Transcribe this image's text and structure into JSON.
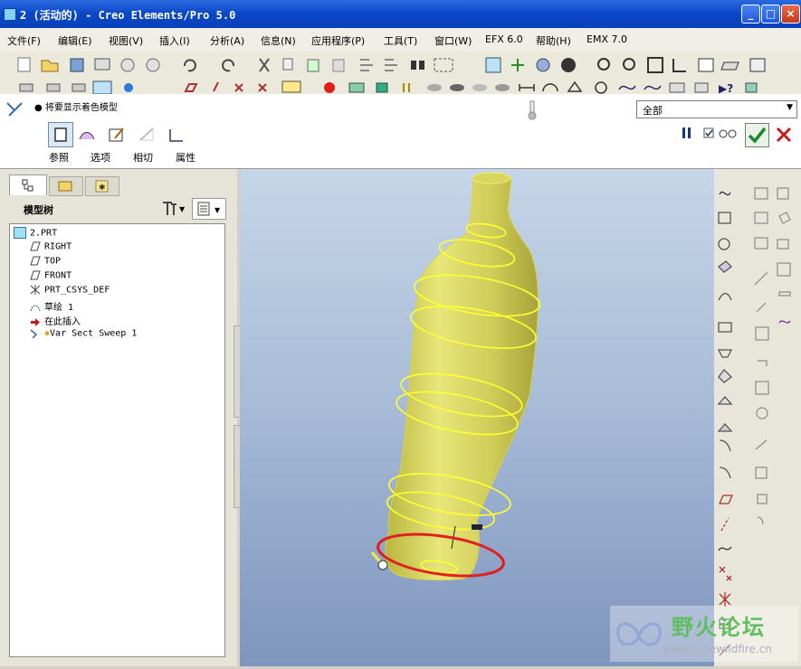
{
  "window": {
    "title": "2 (活动的) - Creo Elements/Pro 5.0"
  },
  "menu": [
    "文件(F)",
    "编辑(E)",
    "视图(V)",
    "插入(I)",
    "分析(A)",
    "信息(N)",
    "应用程序(P)",
    "工具(T)",
    "窗口(W)",
    "EFX 6.0",
    "帮助(H)",
    "EMX 7.0"
  ],
  "dashboard": {
    "message": "将要显示着色模型",
    "filter_value": "全部",
    "tabs": [
      "参照",
      "选项",
      "相切",
      "属性"
    ]
  },
  "model_tree": {
    "title": "模型树",
    "items": [
      "2.PRT",
      "RIGHT",
      "TOP",
      "FRONT",
      "PRT_CSYS_DEF",
      "草绘 1",
      "在此插入",
      "Var Sect Sweep 1"
    ]
  },
  "watermark": {
    "text": "野火论坛",
    "url": "www.proewildfire.cn"
  },
  "colors": {
    "model": "#e6e36a",
    "highlight_edge": "#ffff30",
    "selection_ellipse": "#e02020"
  }
}
